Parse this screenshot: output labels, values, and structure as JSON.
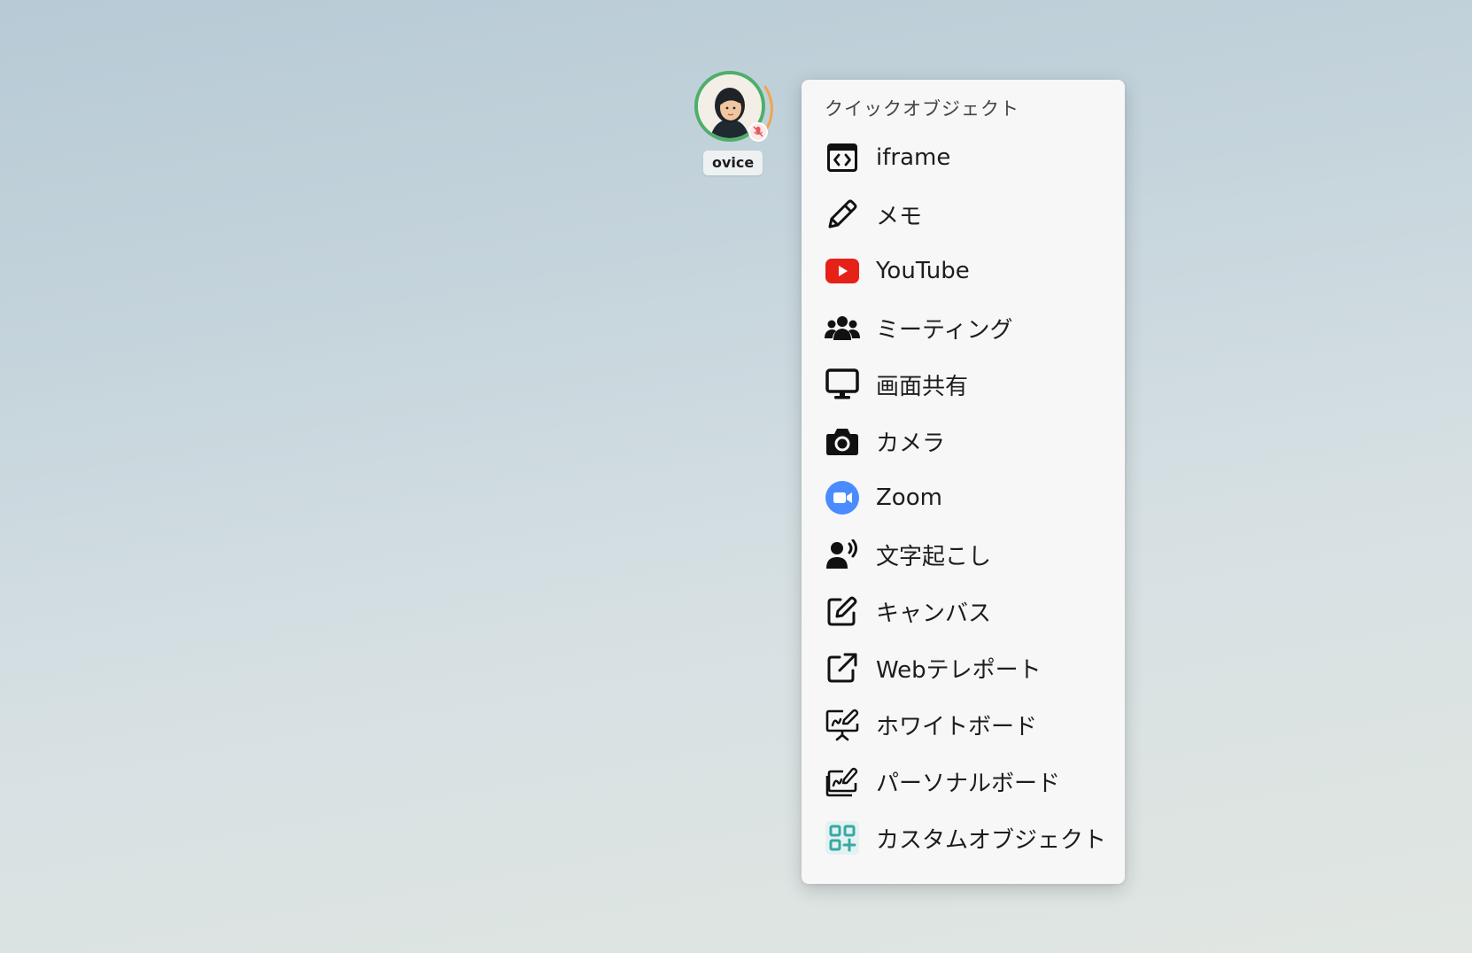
{
  "user": {
    "name": "ovice",
    "ring_color": "#4caf6a",
    "mic_status": "muted"
  },
  "menu": {
    "title": "クイックオブジェクト",
    "items": [
      {
        "label": "iframe",
        "icon": "iframe-icon"
      },
      {
        "label": "メモ",
        "icon": "pencil-icon"
      },
      {
        "label": "YouTube",
        "icon": "youtube-icon",
        "color": "#e62117"
      },
      {
        "label": "ミーティング",
        "icon": "people-group-icon"
      },
      {
        "label": "画面共有",
        "icon": "monitor-icon"
      },
      {
        "label": "カメラ",
        "icon": "camera-icon"
      },
      {
        "label": "Zoom",
        "icon": "zoom-icon",
        "color": "#4a8cff"
      },
      {
        "label": "文字起こし",
        "icon": "speaking-person-icon"
      },
      {
        "label": "キャンバス",
        "icon": "edit-square-icon"
      },
      {
        "label": "Webテレポート",
        "icon": "external-link-icon"
      },
      {
        "label": "ホワイトボード",
        "icon": "whiteboard-icon"
      },
      {
        "label": "パーソナルボード",
        "icon": "personal-board-icon"
      },
      {
        "label": "カスタムオブジェクト",
        "icon": "grid-plus-icon",
        "color": "#3aa8a4"
      }
    ]
  }
}
